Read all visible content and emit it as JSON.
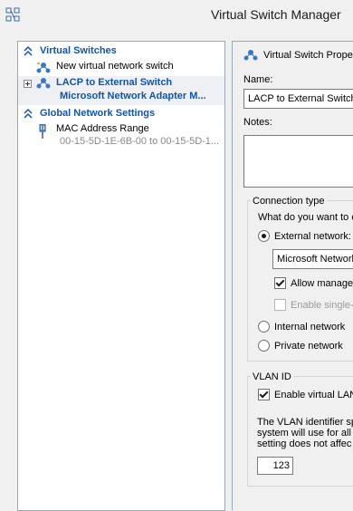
{
  "window": {
    "title": "Virtual Switch Manager"
  },
  "left": {
    "virtual_switches_header": "Virtual Switches",
    "new_switch_label": "New virtual network switch",
    "lacp_switch_name": "LACP to External Switch",
    "lacp_switch_adapter": "Microsoft Network Adapter M...",
    "global_settings_header": "Global Network Settings",
    "mac_label": "MAC Address Range",
    "mac_range": "00-15-5D-1E-6B-00 to 00-15-5D-1..."
  },
  "right": {
    "panel_title": "Virtual Switch Proper",
    "name_label": "Name:",
    "name_value": "LACP to External Switch",
    "notes_label": "Notes:",
    "notes_value": "",
    "connection_type_label": "Connection type",
    "connection_question": "What do you want to c",
    "external_label": "External network:",
    "external_adapter": "Microsoft Network",
    "allow_mgmt_label": "Allow managem",
    "single_root_label": "Enable single-r",
    "internal_label": "Internal network",
    "private_label": "Private network",
    "vlan_group_label": "VLAN ID",
    "enable_vlan_label": "Enable virtual LAN",
    "vlan_desc_1": "The VLAN identifier spe",
    "vlan_desc_2": "system will use for all n",
    "vlan_desc_3": "setting does not affec",
    "vlan_value": "123"
  },
  "colors": {
    "accent": "#0f55b0",
    "border": "#9aa7b6"
  }
}
